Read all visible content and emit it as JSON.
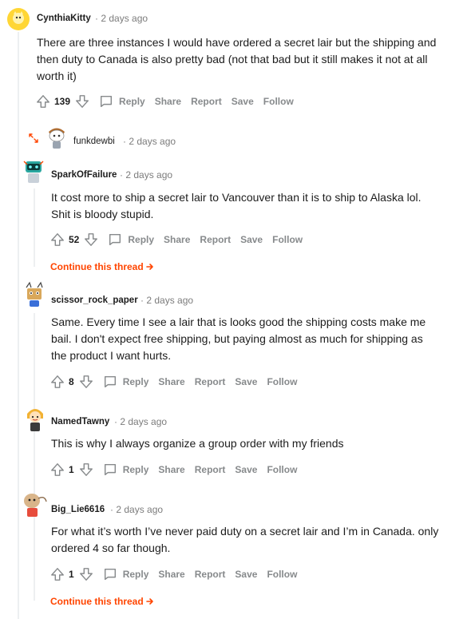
{
  "comments": [
    {
      "username": "CynthiaKitty",
      "time": "2 days ago",
      "body_lines": [
        "There are three instances I would have ordered a secret lair but the shipping and",
        "then duty to Canada is also pretty bad (not that bad but it still makes it not at all",
        "worth it)"
      ],
      "votes": "139"
    },
    {
      "username": "funkdewbi",
      "time": "2 days ago"
    },
    {
      "username": "SparkOfFailure",
      "time": "2 days ago",
      "body_lines": [
        "It cost more to ship a secret lair to Vancouver than it is to ship to Alaska lol.",
        "Shit is bloody stupid."
      ],
      "votes": "52",
      "continue": "Continue this thread"
    },
    {
      "username": "scissor_rock_paper",
      "time": "2 days ago",
      "body_lines": [
        "Same. Every time I see a lair that is looks good the shipping costs make me",
        "bail. I don't expect free shipping, but paying almost as much for shipping as",
        "the product I want hurts."
      ],
      "votes": "8"
    },
    {
      "username": "NamedTawny",
      "time": "2 days ago",
      "body_lines": [
        "This is why I always organize a group order with my friends"
      ],
      "votes": "1"
    },
    {
      "username": "Big_Lie6616",
      "time": "2 days ago",
      "body_lines": [
        "For what it’s worth I’ve never paid duty on a secret lair and I’m in Canada. only",
        "ordered 4 so far though."
      ],
      "votes": "1",
      "continue": "Continue this thread"
    }
  ],
  "actions": {
    "reply": "Reply",
    "share": "Share",
    "report": "Report",
    "save": "Save",
    "follow": "Follow"
  },
  "separator": "·",
  "icons": {
    "upvote": "upvote-arrow-icon",
    "downvote": "downvote-arrow-icon",
    "reply": "speech-bubble-icon",
    "continue": "arrow-right-icon",
    "expand": "expand-arrows-icon"
  },
  "colors": {
    "accent": "#ff4500",
    "meta": "#7c7c7c",
    "action": "#878a8c",
    "thread_line": "#edeff1"
  }
}
